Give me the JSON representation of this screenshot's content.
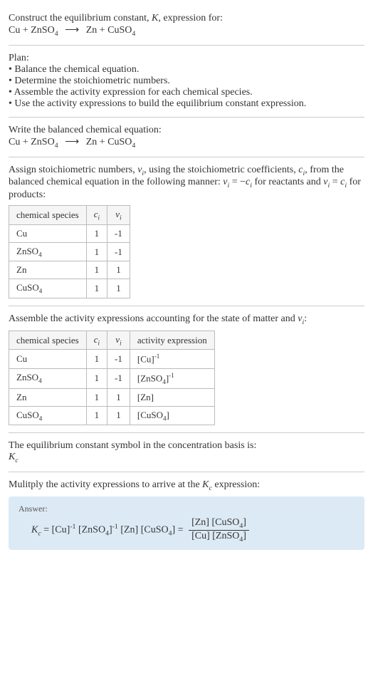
{
  "intro": {
    "prompt": "Construct the equilibrium constant, ",
    "K": "K",
    "prompt2": ", expression for:"
  },
  "equation": {
    "r1": "Cu",
    "plus": " + ",
    "r2a": "ZnSO",
    "r2s": "4",
    "arrow": "⟶",
    "p1": "Zn",
    "p2a": "CuSO",
    "p2s": "4"
  },
  "plan": {
    "label": "Plan:",
    "b1": "Balance the chemical equation.",
    "b2": "Determine the stoichiometric numbers.",
    "b3": "Assemble the activity expression for each chemical species.",
    "b4": "Use the activity expressions to build the equilibrium constant expression."
  },
  "balance": {
    "label": "Write the balanced chemical equation:"
  },
  "stoich": {
    "text1": "Assign stoichiometric numbers, ",
    "nui": "ν",
    "nuis": "i",
    "text2": ", using the stoichiometric coefficients, ",
    "ci": "c",
    "cis": "i",
    "text3": ", from the balanced chemical equation in the following manner: ",
    "eq1a": "ν",
    "eq1s": "i",
    "eq1b": " = −",
    "eq1c": "c",
    "eq1cs": "i",
    "text4": " for reactants and ",
    "eq2a": "ν",
    "eq2s": "i",
    "eq2b": " = ",
    "eq2c": "c",
    "eq2cs": "i",
    "text5": " for products:"
  },
  "table1": {
    "h1": "chemical species",
    "h2": "c",
    "h2s": "i",
    "h3": "ν",
    "h3s": "i",
    "rows": [
      {
        "sp": "Cu",
        "spSub": "",
        "c": "1",
        "nu": "-1"
      },
      {
        "sp": "ZnSO",
        "spSub": "4",
        "c": "1",
        "nu": "-1"
      },
      {
        "sp": "Zn",
        "spSub": "",
        "c": "1",
        "nu": "1"
      },
      {
        "sp": "CuSO",
        "spSub": "4",
        "c": "1",
        "nu": "1"
      }
    ]
  },
  "activity": {
    "text1": "Assemble the activity expressions accounting for the state of matter and ",
    "nui": "ν",
    "nuis": "i",
    "text2": ":"
  },
  "table2": {
    "h1": "chemical species",
    "h2": "c",
    "h2s": "i",
    "h3": "ν",
    "h3s": "i",
    "h4": "activity expression",
    "rows": [
      {
        "sp": "Cu",
        "spSub": "",
        "c": "1",
        "nu": "-1",
        "ae": "[Cu]",
        "aeSup": "-1",
        "aeSub": ""
      },
      {
        "sp": "ZnSO",
        "spSub": "4",
        "c": "1",
        "nu": "-1",
        "ae": "[ZnSO",
        "aeSub": "4",
        "aeClose": "]",
        "aeSup": "-1"
      },
      {
        "sp": "Zn",
        "spSub": "",
        "c": "1",
        "nu": "1",
        "ae": "[Zn]",
        "aeSup": "",
        "aeSub": ""
      },
      {
        "sp": "CuSO",
        "spSub": "4",
        "c": "1",
        "nu": "1",
        "ae": "[CuSO",
        "aeSub": "4",
        "aeClose": "]",
        "aeSup": ""
      }
    ]
  },
  "kcIntro": {
    "text": "The equilibrium constant symbol in the concentration basis is:",
    "K": "K",
    "ks": "c"
  },
  "multiply": {
    "text1": "Mulitply the activity expressions to arrive at the ",
    "K": "K",
    "ks": "c",
    "text2": " expression:"
  },
  "answer": {
    "label": "Answer:",
    "K": "K",
    "ks": "c",
    "eq": " = ",
    "t1": "[Cu]",
    "s1": "-1",
    "t2": " [ZnSO",
    "t2s": "4",
    "t2c": "]",
    "s2": "-1",
    "t3": " [Zn] [CuSO",
    "t3s": "4",
    "t3c": "] = ",
    "numA": "[Zn] [CuSO",
    "numS": "4",
    "numC": "]",
    "denA": "[Cu] [ZnSO",
    "denS": "4",
    "denC": "]"
  }
}
